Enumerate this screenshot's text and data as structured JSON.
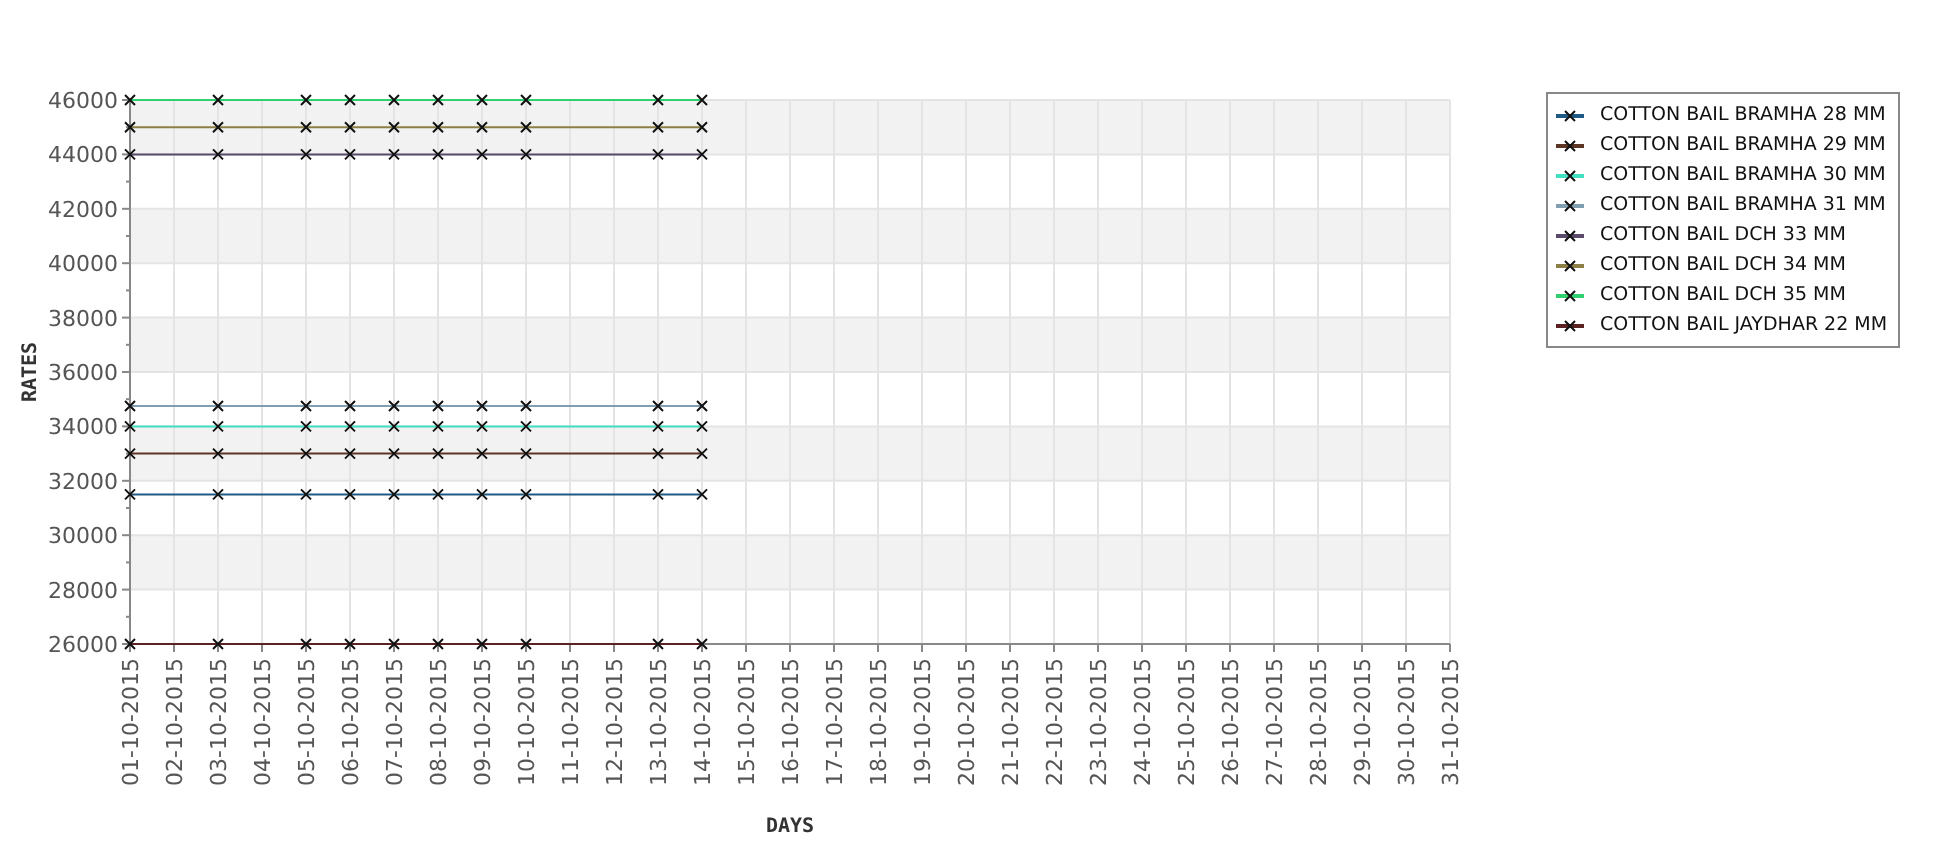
{
  "chart_data": {
    "type": "line",
    "xlabel": "DAYS",
    "ylabel": "RATES",
    "categories": [
      "01-10-2015",
      "02-10-2015",
      "03-10-2015",
      "04-10-2015",
      "05-10-2015",
      "06-10-2015",
      "07-10-2015",
      "08-10-2015",
      "09-10-2015",
      "10-10-2015",
      "11-10-2015",
      "12-10-2015",
      "13-10-2015",
      "14-10-2015",
      "15-10-2015",
      "16-10-2015",
      "17-10-2015",
      "18-10-2015",
      "19-10-2015",
      "20-10-2015",
      "21-10-2015",
      "22-10-2015",
      "23-10-2015",
      "24-10-2015",
      "25-10-2015",
      "26-10-2015",
      "27-10-2015",
      "28-10-2015",
      "29-10-2015",
      "30-10-2015",
      "31-10-2015"
    ],
    "ylim": [
      26000,
      46000
    ],
    "grid": true,
    "yticks": [
      26000,
      28000,
      30000,
      32000,
      34000,
      36000,
      38000,
      40000,
      42000,
      44000,
      46000
    ],
    "series": [
      {
        "name": "COTTON BAIL BRAMHA 28 MM",
        "color": "#1f5a85",
        "marker": "x",
        "values": [
          31500,
          null,
          31500,
          null,
          31500,
          31500,
          31500,
          31500,
          31500,
          31500,
          null,
          null,
          31500,
          31500,
          null,
          null,
          null,
          null,
          null,
          null,
          null,
          null,
          null,
          null,
          null,
          null,
          null,
          null,
          null,
          null,
          null
        ]
      },
      {
        "name": "COTTON BAIL BRAMHA 29 MM",
        "color": "#5c3524",
        "marker": "x",
        "values": [
          33000,
          null,
          33000,
          null,
          33000,
          33000,
          33000,
          33000,
          33000,
          33000,
          null,
          null,
          33000,
          33000,
          null,
          null,
          null,
          null,
          null,
          null,
          null,
          null,
          null,
          null,
          null,
          null,
          null,
          null,
          null,
          null,
          null
        ]
      },
      {
        "name": "COTTON BAIL BRAMHA 30 MM",
        "color": "#40e0c0",
        "marker": "x",
        "values": [
          34000,
          null,
          34000,
          null,
          34000,
          34000,
          34000,
          34000,
          34000,
          34000,
          null,
          null,
          34000,
          34000,
          null,
          null,
          null,
          null,
          null,
          null,
          null,
          null,
          null,
          null,
          null,
          null,
          null,
          null,
          null,
          null,
          null
        ]
      },
      {
        "name": "COTTON BAIL BRAMHA 31 MM",
        "color": "#7f9fb0",
        "marker": "x",
        "values": [
          34750,
          null,
          34750,
          null,
          34750,
          34750,
          34750,
          34750,
          34750,
          34750,
          null,
          null,
          34750,
          34750,
          null,
          null,
          null,
          null,
          null,
          null,
          null,
          null,
          null,
          null,
          null,
          null,
          null,
          null,
          null,
          null,
          null
        ]
      },
      {
        "name": "COTTON BAIL DCH 33 MM",
        "color": "#5a4a6a",
        "marker": "x",
        "values": [
          44000,
          null,
          44000,
          null,
          44000,
          44000,
          44000,
          44000,
          44000,
          44000,
          null,
          null,
          44000,
          44000,
          null,
          null,
          null,
          null,
          null,
          null,
          null,
          null,
          null,
          null,
          null,
          null,
          null,
          null,
          null,
          null,
          null
        ]
      },
      {
        "name": "COTTON BAIL DCH 34 MM",
        "color": "#8b7f45",
        "marker": "x",
        "values": [
          45000,
          null,
          45000,
          null,
          45000,
          45000,
          45000,
          45000,
          45000,
          45000,
          null,
          null,
          45000,
          45000,
          null,
          null,
          null,
          null,
          null,
          null,
          null,
          null,
          null,
          null,
          null,
          null,
          null,
          null,
          null,
          null,
          null
        ]
      },
      {
        "name": "COTTON BAIL DCH 35 MM",
        "color": "#30d070",
        "marker": "x",
        "values": [
          46000,
          null,
          46000,
          null,
          46000,
          46000,
          46000,
          46000,
          46000,
          46000,
          null,
          null,
          46000,
          46000,
          null,
          null,
          null,
          null,
          null,
          null,
          null,
          null,
          null,
          null,
          null,
          null,
          null,
          null,
          null,
          null,
          null
        ]
      },
      {
        "name": "COTTON BAIL JAYDHAR 22 MM",
        "color": "#5a2222",
        "marker": "x",
        "values": [
          26000,
          null,
          26000,
          null,
          26000,
          26000,
          26000,
          26000,
          26000,
          26000,
          null,
          null,
          26000,
          26000,
          null,
          null,
          null,
          null,
          null,
          null,
          null,
          null,
          null,
          null,
          null,
          null,
          null,
          null,
          null,
          null,
          null
        ]
      }
    ]
  }
}
